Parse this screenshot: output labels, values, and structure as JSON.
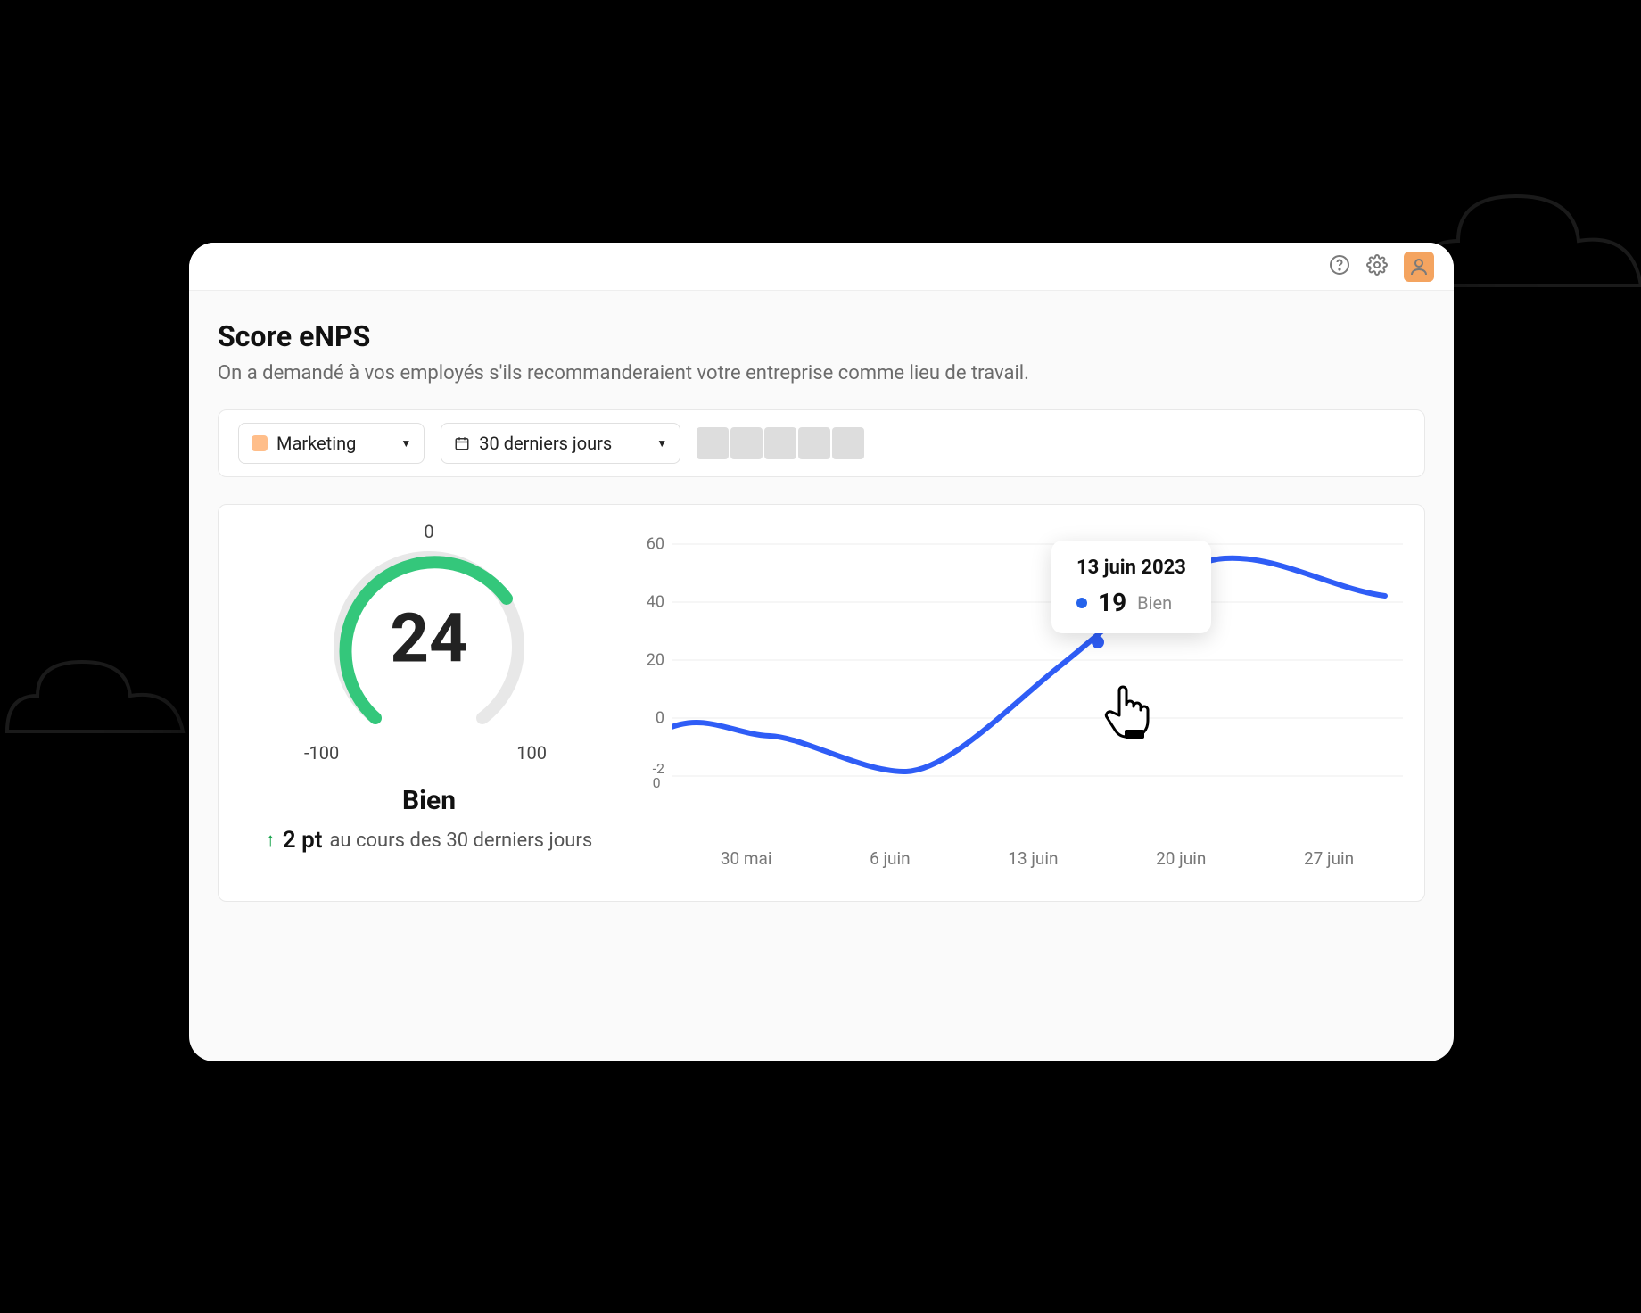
{
  "header": {
    "title": "Score eNPS",
    "subtitle": "On a demandé à vos employés s'ils recommanderaient votre entreprise comme lieu de travail."
  },
  "filters": {
    "team_label": "Marketing",
    "date_range_label": "30 derniers jours",
    "avatar_count": 5
  },
  "gauge": {
    "value": "24",
    "top_label": "0",
    "left_label": "-100",
    "right_label": "100",
    "rating": "Bien",
    "trend_points": "2 pt",
    "trend_period": "au cours des 30 derniers jours"
  },
  "tooltip": {
    "date": "13 juin 2023",
    "value": "19",
    "rating": "Bien"
  },
  "chart_data": {
    "type": "line",
    "title": "Score eNPS",
    "xlabel": "",
    "ylabel": "",
    "ylim": [
      -20,
      60
    ],
    "y_ticks": [
      60,
      40,
      20,
      0,
      -20
    ],
    "categories": [
      "30 mai",
      "6 juin",
      "13 juin",
      "20 juin",
      "27 juin"
    ],
    "series": [
      {
        "name": "eNPS",
        "color": "#2563eb",
        "values": [
          -6,
          -18,
          19,
          55,
          42
        ]
      }
    ],
    "highlight": {
      "x": "13 juin",
      "value": 19,
      "date_label": "13 juin 2023",
      "rating": "Bien"
    }
  },
  "colors": {
    "accent": "#2563eb",
    "positive": "#16a34a",
    "gauge_arc": "#34c77b"
  }
}
